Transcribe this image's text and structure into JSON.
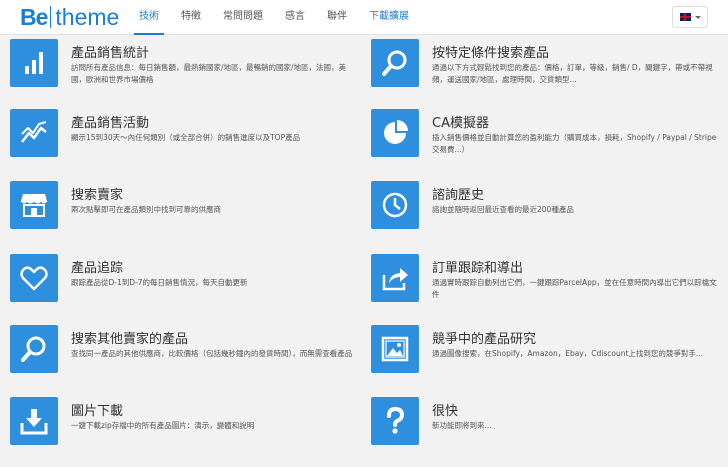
{
  "header": {
    "logo": {
      "be": "Be",
      "theme": "theme"
    },
    "nav": [
      {
        "label": "技術"
      },
      {
        "label": "特徵"
      },
      {
        "label": "常問問題"
      },
      {
        "label": "感言"
      },
      {
        "label": "聯伴"
      },
      {
        "label": "下載擴展"
      }
    ],
    "language_flag": "uk-flag-icon"
  },
  "features": [
    {
      "title": "產品銷售統計",
      "desc": "訪問所有產品信息：每日銷售額，最熱銷國家/地區，最暢銷的國家/地區，法國，美國，歐洲和世界市場價格",
      "icon": "bar-chart-icon"
    },
    {
      "title": "按特定條件搜索產品",
      "desc": "通過以下方式輕鬆找到您的產品：價格，訂單，等級，銷售/ D，關鍵字，帶或不帶視頻，運送國家/地區，處理時間，交貨類型...",
      "icon": "magnifier-icon"
    },
    {
      "title": "產品銷售活動",
      "desc": "顯示15到30天～內任何類別（或全部合併）的銷售進度以及TOP產品",
      "icon": "trend-line-icon"
    },
    {
      "title": "CA模擬器",
      "desc": "插入銷售價格並自動計算您的盈利能力（購買成本，損耗，Shopify / Paypal / Stripe交易費...）",
      "icon": "pie-chart-icon"
    },
    {
      "title": "搜索賣家",
      "desc": "兩次點擊即可在產品類別中找到可靠的供應商",
      "icon": "store-icon"
    },
    {
      "title": "諮詢歷史",
      "desc": "諮詢並隨時返回最近查看的最近200種產品",
      "icon": "clock-icon"
    },
    {
      "title": "產品追踪",
      "desc": "跟踪產品從D-1到D-7的每日銷售情況，每天自動更新",
      "icon": "heart-icon"
    },
    {
      "title": "訂單跟踪和導出",
      "desc": "通過實時跟踪自動列出它們，一鍵跟踪ParcelApp，並在任意時間內導出它們以踪檔文件",
      "icon": "share-arrow-icon"
    },
    {
      "title": "搜索其他賣家的產品",
      "desc": "查找同一產品的其他供應商，比較價格（包括幾秒鐘內的發貨時間），而無需查看產品",
      "icon": "magnifier-icon"
    },
    {
      "title": "競爭中的產品研究",
      "desc": "通過圖像搜索，在Shopify，Amazon，Ebay，Cdiscount上找到您的競爭對手...",
      "icon": "image-search-icon"
    },
    {
      "title": "圖片下載",
      "desc": "一鍵下載zip存檔中的所有產品圖片：演示，變體和說明",
      "icon": "download-icon"
    },
    {
      "title": "很快",
      "desc": "新功能即將到來...",
      "icon": "question-icon"
    }
  ],
  "colors": {
    "accent": "#1a7fd4",
    "icon_bg": "#2d8fdd",
    "page_bg": "#f2f2f2"
  }
}
